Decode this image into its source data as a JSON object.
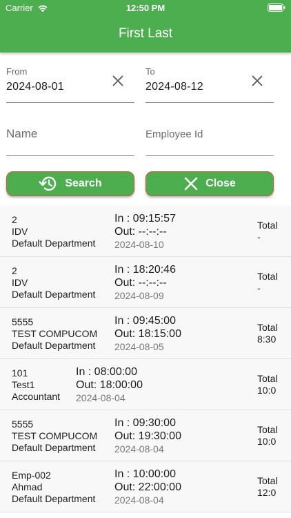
{
  "status_bar": {
    "carrier": "Carrier",
    "time": "12:50 PM"
  },
  "header": {
    "title": "First Last"
  },
  "filters": {
    "from_label": "From",
    "from_value": "2024-08-01",
    "to_label": "To",
    "to_value": "2024-08-12",
    "name_placeholder": "Name",
    "employee_id_placeholder": "Employee Id"
  },
  "buttons": {
    "search_label": "Search",
    "close_label": "Close"
  },
  "colors": {
    "primary": "#4cae4f",
    "button_border": "#c95d3c",
    "row_bg": "#f8f8f8"
  },
  "records": [
    {
      "id": "2",
      "name": "IDV",
      "department": "Default Department",
      "in": "In : 09:15:57",
      "out": "Out: --:--:--",
      "date": "2024-08-10",
      "total_label": "Total",
      "total": "-"
    },
    {
      "id": "2",
      "name": "IDV",
      "department": "Default Department",
      "in": "In : 18:20:46",
      "out": "Out: --:--:--",
      "date": "2024-08-09",
      "total_label": "Total",
      "total": "-"
    },
    {
      "id": "5555",
      "name": "TEST COMPUCOM",
      "department": "Default Department",
      "in": "In : 09:45:00",
      "out": "Out: 18:15:00",
      "date": "2024-08-05",
      "total_label": "Total",
      "total": "8:30"
    },
    {
      "id": "101",
      "name": "Test1",
      "department": "Accountant",
      "in": "In : 08:00:00",
      "out": "Out: 18:00:00",
      "date": "2024-08-04",
      "total_label": "Total",
      "total": "10:0"
    },
    {
      "id": "5555",
      "name": "TEST COMPUCOM",
      "department": "Default Department",
      "in": "In : 09:30:00",
      "out": "Out: 19:30:00",
      "date": "2024-08-04",
      "total_label": "Total",
      "total": "10:0"
    },
    {
      "id": "Emp-002",
      "name": "Ahmad",
      "department": "Default Department",
      "in": "In : 10:00:00",
      "out": "Out: 22:00:00",
      "date": "2024-08-04",
      "total_label": "Total",
      "total": "12:0"
    }
  ]
}
